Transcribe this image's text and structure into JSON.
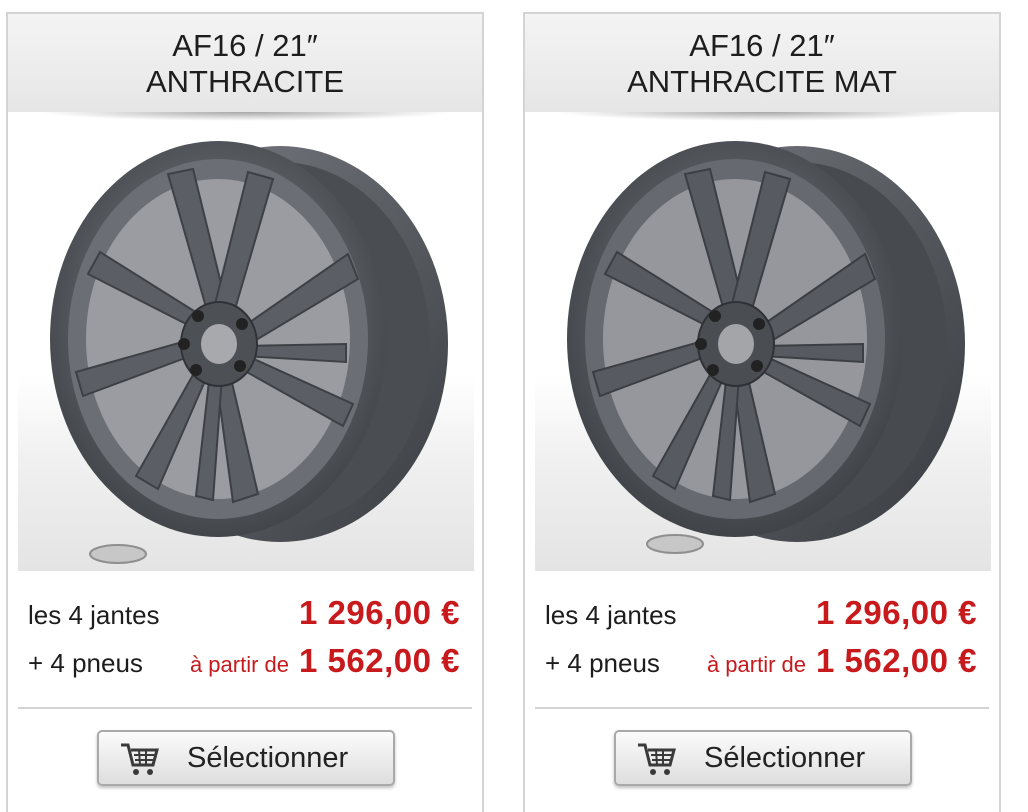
{
  "products": [
    {
      "title_line1": "AF16 / 21″",
      "title_line2": "ANTHRACITE",
      "rims_label": "les 4 jantes",
      "rims_price": "1 296,00 €",
      "tyres_label": "+ 4 pneus",
      "tyres_from": "à partir de",
      "tyres_price": "1 562,00 €",
      "button_label": "Sélectionner",
      "button_icon": "cart-icon"
    },
    {
      "title_line1": "AF16 / 21″",
      "title_line2": "ANTHRACITE MAT",
      "rims_label": "les 4 jantes",
      "rims_price": "1 296,00 €",
      "tyres_label": "+ 4 pneus",
      "tyres_from": "à partir de",
      "tyres_price": "1 562,00 €",
      "button_label": "Sélectionner",
      "button_icon": "cart-icon"
    }
  ],
  "colors": {
    "price_red": "#c8191c",
    "header_bg": "#eeeeee",
    "border": "#d4d4d4",
    "wheel_anthracite": "#5b5e64"
  }
}
